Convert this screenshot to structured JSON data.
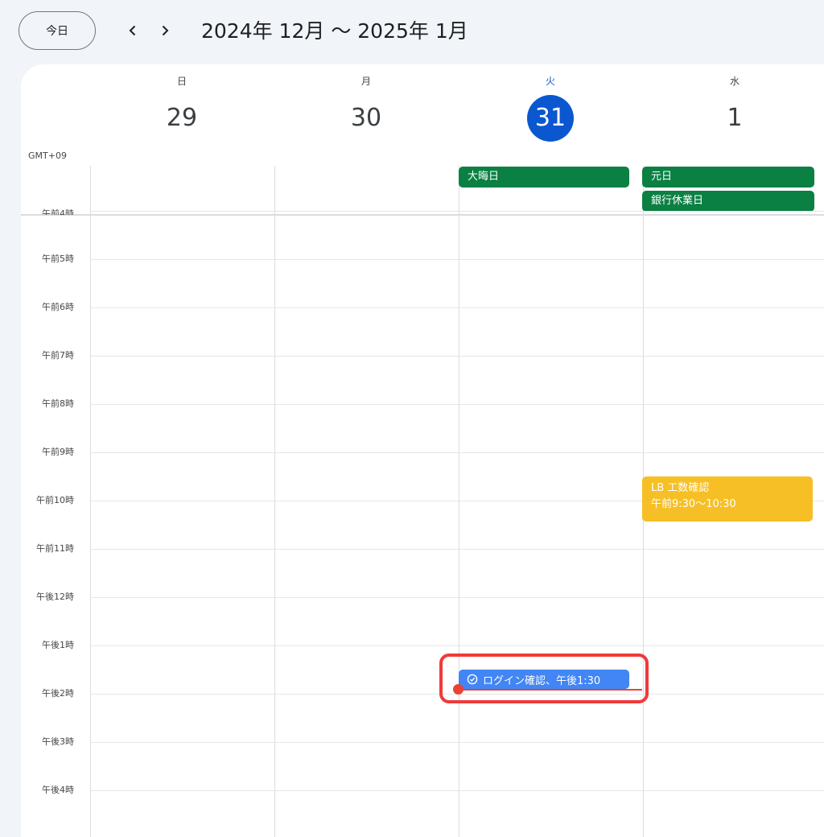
{
  "header": {
    "today_button": "今日",
    "prev_icon": "chevron-left-icon",
    "next_icon": "chevron-right-icon",
    "date_range": "2024年 12月 〜 2025年 1月"
  },
  "timezone": "GMT+09",
  "days": [
    {
      "dow": "日",
      "date": "29",
      "today": false
    },
    {
      "dow": "月",
      "date": "30",
      "today": false
    },
    {
      "dow": "火",
      "date": "31",
      "today": true
    },
    {
      "dow": "水",
      "date": "1",
      "today": false
    }
  ],
  "all_day_events": [
    {
      "day": 2,
      "title": "大晦日"
    },
    {
      "day": 3,
      "title": "元日"
    },
    {
      "day": 3,
      "title": "銀行休業日"
    }
  ],
  "hours": [
    "午前4時",
    "午前5時",
    "午前6時",
    "午前7時",
    "午前8時",
    "午前9時",
    "午前10時",
    "午前11時",
    "午後12時",
    "午後1時",
    "午後2時",
    "午後3時",
    "午後4時"
  ],
  "events": [
    {
      "day": 3,
      "title": "LB 工数確認",
      "time": "午前9:30〜10:30",
      "color": "#f6bf26"
    }
  ],
  "tasks": [
    {
      "day": 2,
      "label": "ログイン確認、午後1:30",
      "icon": "task-check-icon",
      "color": "#4285f4"
    }
  ],
  "colors": {
    "accent": "#0b57d0",
    "holiday": "#0b8043",
    "now_indicator": "#ea4335",
    "highlight_box": "#f03a3a"
  }
}
